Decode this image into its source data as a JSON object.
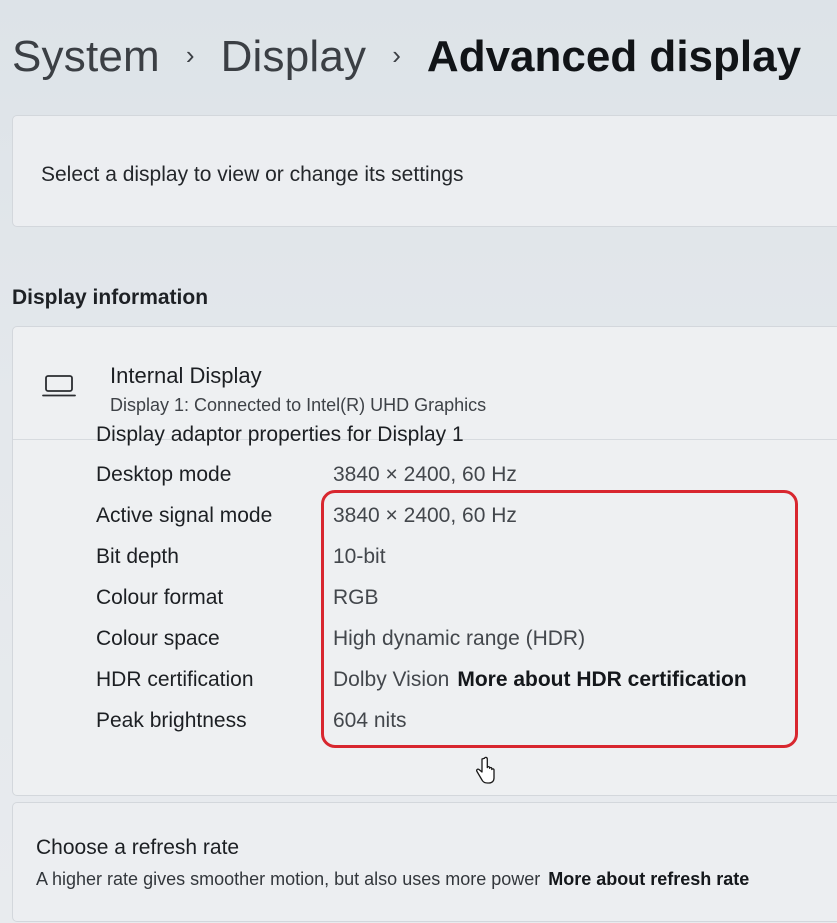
{
  "breadcrumb": {
    "items": [
      "System",
      "Display"
    ],
    "current": "Advanced display",
    "separator": "›"
  },
  "select_display": {
    "text": "Select a display to view or change its settings"
  },
  "display_information": {
    "section_title": "Display information",
    "icon": "laptop-icon",
    "name": "Internal Display",
    "subtitle": "Display 1: Connected to Intel(R) UHD Graphics",
    "rows": [
      {
        "label": "Desktop mode",
        "value": "3840 × 2400, 60 Hz"
      },
      {
        "label": "Active signal mode",
        "value": "3840 × 2400, 60 Hz"
      },
      {
        "label": "Bit depth",
        "value": "10-bit"
      },
      {
        "label": "Colour format",
        "value": "RGB"
      },
      {
        "label": "Colour space",
        "value": "High dynamic range (HDR)"
      },
      {
        "label": "HDR certification",
        "value": "Dolby Vision",
        "link": "More about HDR certification"
      },
      {
        "label": "Peak brightness",
        "value": "604 nits"
      }
    ],
    "adapter_link": "Display adaptor properties for Display 1"
  },
  "refresh_rate": {
    "title": "Choose a refresh rate",
    "subtitle": "A higher rate gives smoother motion, but also uses more power",
    "link": "More about refresh rate"
  },
  "colors": {
    "highlight": "#d8272f",
    "background": "#e4e8ec",
    "card": "#eceef1"
  }
}
